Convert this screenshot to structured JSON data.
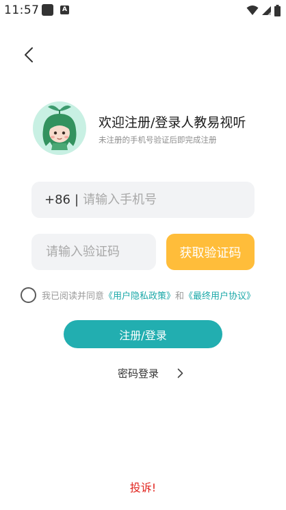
{
  "status_bar": {
    "time": "11:57"
  },
  "header": {
    "back_icon": "chevron-left-icon"
  },
  "welcome": {
    "title": "欢迎注册/登录人教易视听",
    "subtitle": "未注册的手机号验证后即完成注册"
  },
  "phone": {
    "prefix": "+86",
    "separator": "|",
    "placeholder": "请输入手机号",
    "value": ""
  },
  "code": {
    "placeholder": "请输入验证码",
    "value": "",
    "button_label": "获取验证码"
  },
  "agreement": {
    "checked": false,
    "prefix": "我已阅读并同意",
    "privacy_link": "《用户隐私政策》",
    "conjunction": "和",
    "terms_link": "《最终用户协议》"
  },
  "submit_label": "注册/登录",
  "password_login_label": "密码登录",
  "complain_label": "投诉!",
  "colors": {
    "accent": "#22aeb0",
    "code_button": "#ffbd3a",
    "complain": "#e1231d",
    "link": "#1aa8a8"
  }
}
